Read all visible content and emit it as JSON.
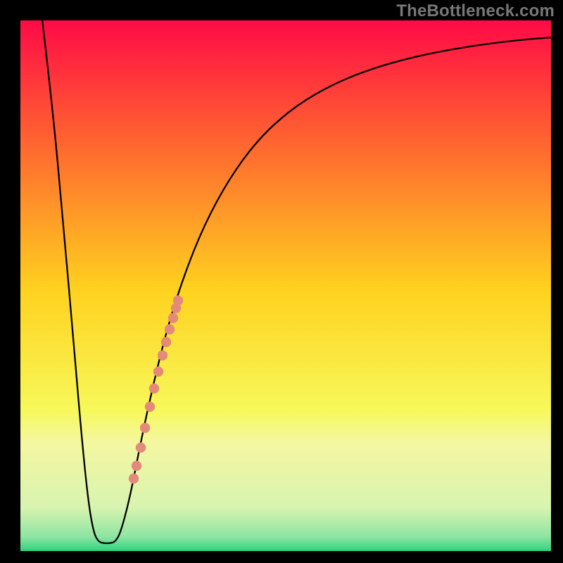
{
  "watermark": "TheBottleneck.com",
  "chart_data": {
    "type": "line",
    "title": "",
    "xlabel": "",
    "ylabel": "",
    "xlim": [
      28,
      798
    ],
    "ylim": [
      28,
      798
    ],
    "notes": "Plot with rainbow vertical gradient background (red top → green bottom) and a black V-shaped curve; salmon dot markers lie along the right arm of the V roughly between y ≈ 0.30 and y ≈ 0.45 of the panel height.",
    "background_gradient_stops": [
      {
        "offset": 0.0,
        "color": "#ff0a46"
      },
      {
        "offset": 0.24,
        "color": "#ff6a2f"
      },
      {
        "offset": 0.5,
        "color": "#ffd21f"
      },
      {
        "offset": 0.72,
        "color": "#f7f85a"
      },
      {
        "offset": 0.78,
        "color": "#f4f7a0"
      },
      {
        "offset": 0.9,
        "color": "#d8f4b0"
      },
      {
        "offset": 0.955,
        "color": "#8de4a2"
      },
      {
        "offset": 0.98,
        "color": "#2fd37e"
      },
      {
        "offset": 1.0,
        "color": "#15c86a"
      }
    ],
    "series": [
      {
        "name": "curve",
        "type": "line",
        "color": "#000000",
        "width": 2.3,
        "points": [
          {
            "x": 60,
            "y": 28
          },
          {
            "x": 75,
            "y": 155
          },
          {
            "x": 90,
            "y": 320
          },
          {
            "x": 105,
            "y": 490
          },
          {
            "x": 115,
            "y": 610
          },
          {
            "x": 125,
            "y": 710
          },
          {
            "x": 133,
            "y": 757
          },
          {
            "x": 140,
            "y": 770
          },
          {
            "x": 148,
            "y": 772
          },
          {
            "x": 156,
            "y": 772
          },
          {
            "x": 164,
            "y": 770
          },
          {
            "x": 172,
            "y": 755
          },
          {
            "x": 185,
            "y": 705
          },
          {
            "x": 200,
            "y": 628
          },
          {
            "x": 218,
            "y": 545
          },
          {
            "x": 238,
            "y": 465
          },
          {
            "x": 262,
            "y": 390
          },
          {
            "x": 290,
            "y": 320
          },
          {
            "x": 325,
            "y": 255
          },
          {
            "x": 365,
            "y": 200
          },
          {
            "x": 410,
            "y": 158
          },
          {
            "x": 460,
            "y": 126
          },
          {
            "x": 520,
            "y": 100
          },
          {
            "x": 590,
            "y": 80
          },
          {
            "x": 665,
            "y": 66
          },
          {
            "x": 735,
            "y": 57
          },
          {
            "x": 798,
            "y": 52
          }
        ]
      },
      {
        "name": "dots",
        "type": "scatter",
        "color": "#e48a7a",
        "radius": 7.2,
        "points": [
          {
            "x": 190,
            "y": 680
          },
          {
            "x": 194,
            "y": 662
          },
          {
            "x": 200,
            "y": 636
          },
          {
            "x": 206,
            "y": 608
          },
          {
            "x": 213,
            "y": 578
          },
          {
            "x": 219,
            "y": 552
          },
          {
            "x": 225,
            "y": 528
          },
          {
            "x": 231,
            "y": 505
          },
          {
            "x": 236,
            "y": 486
          },
          {
            "x": 241,
            "y": 468
          },
          {
            "x": 246,
            "y": 452
          },
          {
            "x": 250,
            "y": 438
          },
          {
            "x": 253,
            "y": 427
          }
        ]
      }
    ],
    "frame": {
      "stroke": "#000000",
      "width": 30
    }
  }
}
